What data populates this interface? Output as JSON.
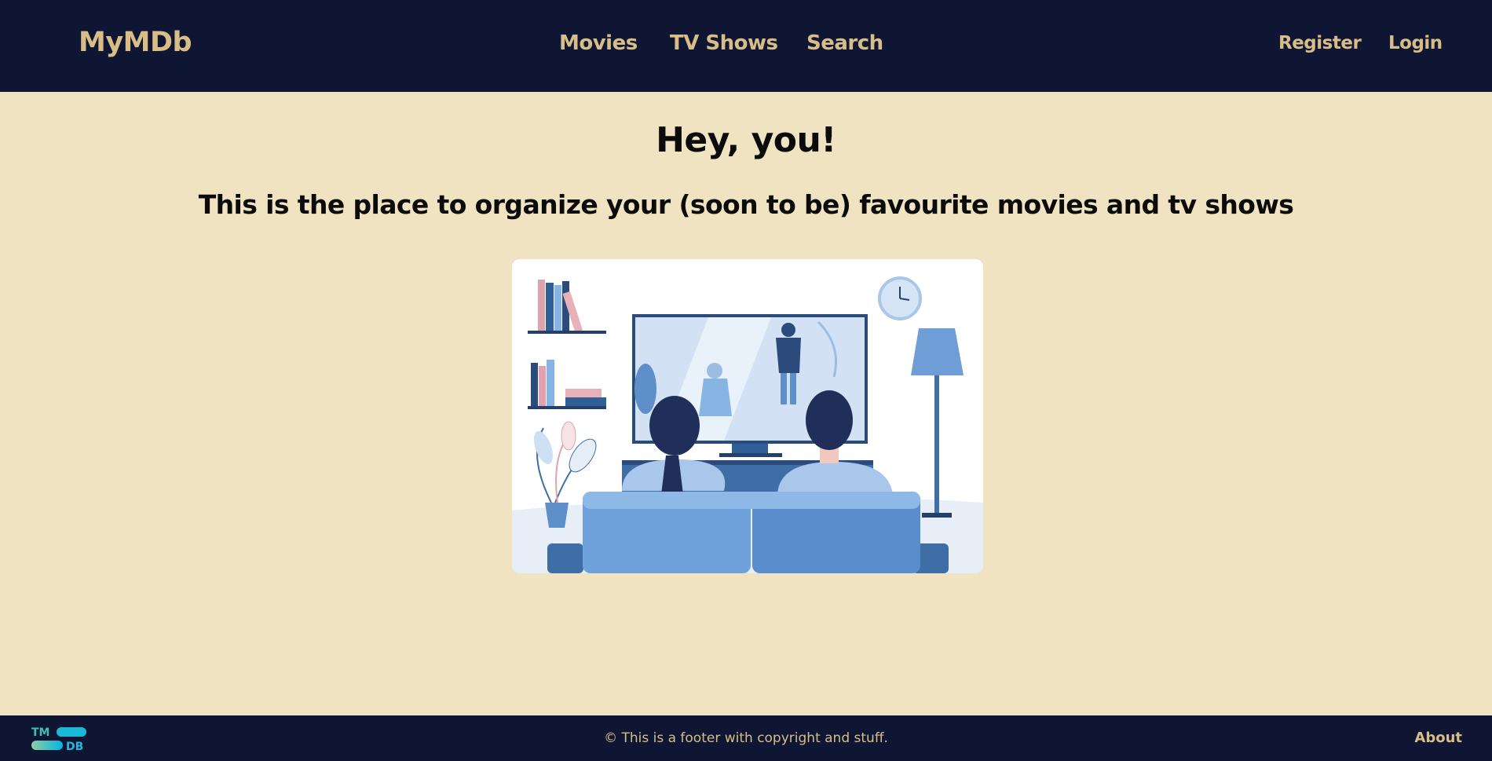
{
  "navbar": {
    "brand": "MyMDb",
    "links": [
      {
        "label": "Movies"
      },
      {
        "label": "TV Shows"
      },
      {
        "label": "Search"
      }
    ],
    "auth": {
      "register": "Register",
      "login": "Login"
    }
  },
  "hero": {
    "title": "Hey, you!",
    "subtitle": "This is the place to organize your (soon to be) favourite movies and tv shows"
  },
  "footer": {
    "logo_top": "TM",
    "logo_bottom": "DB",
    "text": "© This is a footer with copyright and stuff.",
    "about": "About"
  },
  "colors": {
    "nav_background": "#0e1634",
    "page_background": "#f0e3c1",
    "accent_text": "#d9bd86",
    "illustration_blue": "#4a86c8"
  }
}
